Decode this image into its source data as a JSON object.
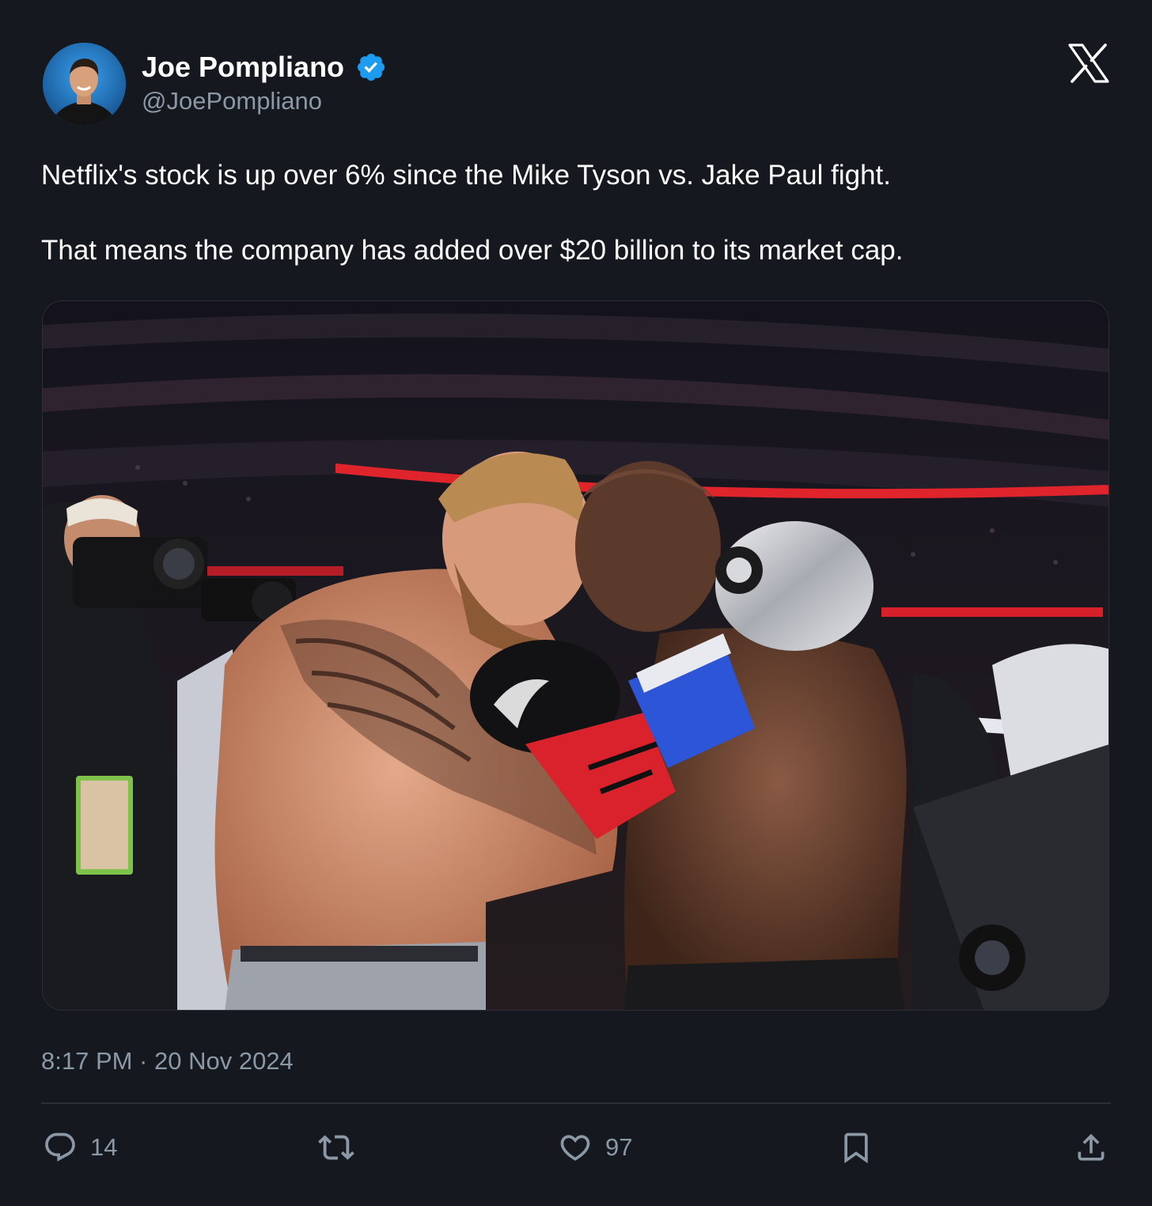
{
  "author": {
    "name": "Joe Pompliano",
    "handle": "@JoePompliano",
    "verified": true,
    "avatar_icon": "profile-photo"
  },
  "tweet": {
    "paragraphs": [
      "Netflix's stock is up over 6% since the Mike Tyson vs. Jake Paul fight.",
      "That means the company has added over $20 billion to its market cap."
    ],
    "media_alt": "Jake Paul and Mike Tyson embracing in the boxing ring"
  },
  "timestamp": "8:17 PM · 20 Nov 2024",
  "actions": {
    "reply_count": "14",
    "repost_count": "",
    "like_count": "97"
  },
  "colors": {
    "background": "#15181f",
    "text_primary": "#ffffff",
    "text_secondary": "#8b98a5",
    "verified_blue": "#1d9bf0",
    "divider": "#2b3038"
  },
  "icons": [
    "verified-badge-icon",
    "x-logo-icon",
    "reply-icon",
    "repost-icon",
    "like-icon",
    "bookmark-icon",
    "share-icon"
  ]
}
